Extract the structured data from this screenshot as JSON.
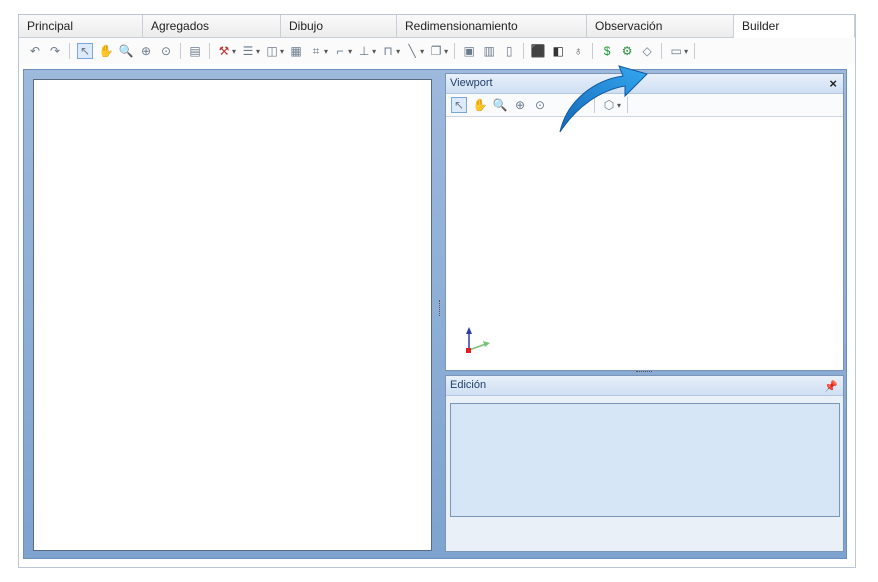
{
  "tabs": [
    {
      "label": "Principal"
    },
    {
      "label": "Agregados"
    },
    {
      "label": "Dibujo"
    },
    {
      "label": "Redimensionamiento"
    },
    {
      "label": "Observación"
    },
    {
      "label": "Builder"
    }
  ],
  "active_tab": "Builder",
  "viewport": {
    "title": "Viewport",
    "close_label": "×"
  },
  "edicion": {
    "title": "Edición"
  },
  "colors": {
    "panel_blue": "#7ea3cf",
    "title_text": "#1f3f6b",
    "arrow": "#1e8fdf"
  }
}
